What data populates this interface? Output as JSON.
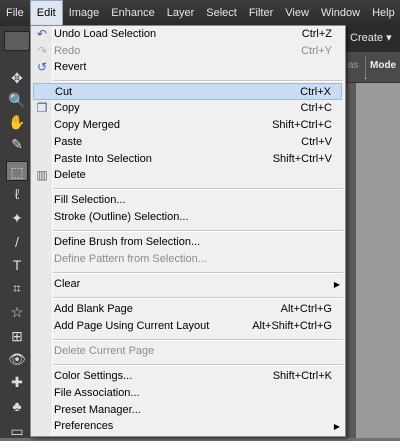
{
  "menubar": {
    "items": [
      {
        "label": "File"
      },
      {
        "label": "Edit"
      },
      {
        "label": "Image"
      },
      {
        "label": "Enhance"
      },
      {
        "label": "Layer"
      },
      {
        "label": "Select"
      },
      {
        "label": "Filter"
      },
      {
        "label": "View"
      },
      {
        "label": "Window"
      },
      {
        "label": "Help"
      }
    ]
  },
  "create_button": {
    "label": "Create ▾"
  },
  "options_bar": {
    "label_faded": "as",
    "label_mode": "Mode"
  },
  "edit_menu": {
    "items": [
      {
        "label": "Undo Load Selection",
        "shortcut": "Ctrl+Z",
        "icon": "undo-icon",
        "enabled": true
      },
      {
        "label": "Redo",
        "shortcut": "Ctrl+Y",
        "icon": "redo-icon",
        "enabled": false
      },
      {
        "label": "Revert",
        "shortcut": "",
        "icon": "revert-icon",
        "enabled": true
      },
      {
        "label": "Cut",
        "shortcut": "Ctrl+X",
        "icon": "",
        "enabled": true,
        "highlighted": true
      },
      {
        "label": "Copy",
        "shortcut": "Ctrl+C",
        "icon": "copy-icon",
        "enabled": true
      },
      {
        "label": "Copy Merged",
        "shortcut": "Shift+Ctrl+C",
        "enabled": true
      },
      {
        "label": "Paste",
        "shortcut": "Ctrl+V",
        "enabled": true
      },
      {
        "label": "Paste Into Selection",
        "shortcut": "Shift+Ctrl+V",
        "enabled": true
      },
      {
        "label": "Delete",
        "shortcut": "",
        "icon": "trash-icon",
        "enabled": true
      },
      {
        "label": "Fill Selection...",
        "shortcut": "",
        "enabled": true
      },
      {
        "label": "Stroke (Outline) Selection...",
        "shortcut": "",
        "enabled": true
      },
      {
        "label": "Define Brush from Selection...",
        "shortcut": "",
        "enabled": true
      },
      {
        "label": "Define Pattern from Selection...",
        "shortcut": "",
        "enabled": false
      },
      {
        "label": "Clear",
        "shortcut": "",
        "submenu": true,
        "enabled": true
      },
      {
        "label": "Add Blank Page",
        "shortcut": "Alt+Ctrl+G",
        "enabled": true
      },
      {
        "label": "Add Page Using Current Layout",
        "shortcut": "Alt+Shift+Ctrl+G",
        "enabled": true
      },
      {
        "label": "Delete Current Page",
        "shortcut": "",
        "enabled": false
      },
      {
        "label": "Color Settings...",
        "shortcut": "Shift+Ctrl+K",
        "enabled": true
      },
      {
        "label": "File Association...",
        "shortcut": "",
        "enabled": true
      },
      {
        "label": "Preset Manager...",
        "shortcut": "",
        "enabled": true
      },
      {
        "label": "Preferences",
        "shortcut": "",
        "submenu": true,
        "enabled": true
      }
    ]
  },
  "icons": {
    "undo": "↶",
    "redo": "↷",
    "revert": "↺",
    "copy": "❐",
    "trash": "🗑",
    "submenu_arrow": "▶"
  },
  "colors": {
    "menubar_bg": "#2f2f2f",
    "menu_bg": "#f0f0f0",
    "highlight": "#c9dcf3",
    "disabled_text": "#8c8c8c"
  }
}
